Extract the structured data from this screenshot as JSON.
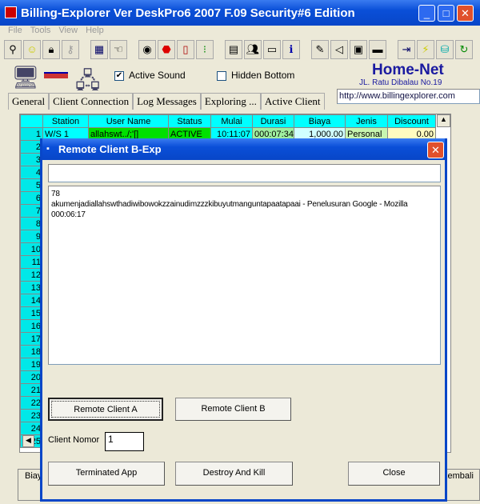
{
  "window": {
    "title": "Billing-Explorer Ver DeskPro6 2007 F.09 Security#6 Edition",
    "minimize": "_",
    "maximize": "□",
    "close": "✕"
  },
  "menu": [
    "File",
    "Tools",
    "View",
    "Help"
  ],
  "toolbar_icons": [
    "binoculars-icon",
    "smiley-icon",
    "lock-icon",
    "key-icon",
    "computer-icon",
    "hand-icon",
    "eye-icon",
    "stop-icon",
    "exit-icon",
    "traffic-icon",
    "printer-icon",
    "users-icon",
    "network-icon",
    "info-icon",
    "pen-icon",
    "speaker-icon",
    "disk-icon",
    "scanner-icon",
    "login-icon",
    "lightning-icon",
    "database-icon",
    "refresh-icon"
  ],
  "options": {
    "active_sound": "Active Sound",
    "active_sound_checked": true,
    "hidden_bottom": "Hidden Bottom",
    "hidden_bottom_checked": false
  },
  "brand": {
    "name": "Home-Net",
    "address": "JL. Ratu Dibalau No.19",
    "url": "http://www.billingexplorer.com"
  },
  "tabs": [
    "General",
    "Client Connection",
    "Log Messages",
    "Exploring ...",
    "Active Client"
  ],
  "grid": {
    "columns": [
      "",
      "Station",
      "User Name",
      "Status",
      "Mulai",
      "Durasi",
      "Biaya",
      "Jenis",
      "Discount"
    ],
    "row1": [
      "1",
      "W/S 1",
      "allahswt../;'[]",
      "ACTIVE",
      "10:11:07",
      "000:07:34",
      "1,000.00",
      "Personal",
      "0.00"
    ],
    "row_numbers": [
      "2",
      "3",
      "4",
      "5",
      "6",
      "7",
      "8",
      "9",
      "10",
      "11",
      "12",
      "13",
      "14",
      "15",
      "16",
      "17",
      "18",
      "19",
      "20",
      "21",
      "22",
      "23",
      "24",
      "25"
    ]
  },
  "bottom": {
    "left_label": "Biaya",
    "right_label": "a Kembali"
  },
  "dialog": {
    "title": "Remote Client B-Exp",
    "top_input": "",
    "log_lines": [
      "78",
      "akumenjadiallahswthadiwibowokzzainudimzzzkibuyutmanguntapaatapaai - Penelusuran Google - Mozilla",
      "000:06:17"
    ],
    "btn_remote_a": "Remote Client A",
    "btn_remote_b": "Remote Client B",
    "client_nomor_label": "Client Nomor",
    "client_nomor_value": "1",
    "btn_terminate": "Terminated App",
    "btn_destroy": "Destroy And Kill",
    "btn_close": "Close",
    "close_x": "✕"
  }
}
